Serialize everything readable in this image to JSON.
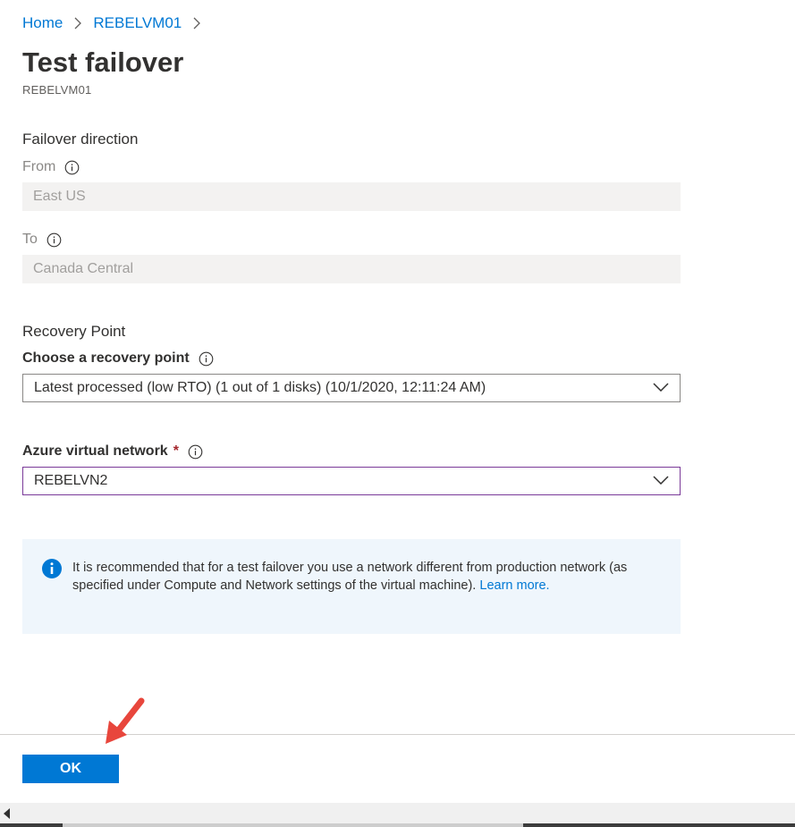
{
  "breadcrumb": {
    "home": "Home",
    "vm": "REBELVM01"
  },
  "header": {
    "title": "Test failover",
    "subtitle": "REBELVM01"
  },
  "failover_direction": {
    "section_label": "Failover direction",
    "from_label": "From",
    "from_value": "East US",
    "to_label": "To",
    "to_value": "Canada Central"
  },
  "recovery_point": {
    "section_label": "Recovery Point",
    "choose_label": "Choose a recovery point",
    "selected": "Latest processed (low RTO) (1 out of 1 disks) (10/1/2020, 12:11:24 AM)"
  },
  "network": {
    "label": "Azure virtual network",
    "required_mark": "*",
    "selected": "REBELVN2"
  },
  "info": {
    "text": "It is recommended that for a test failover you use a network different from production network (as specified under Compute and Network settings of the virtual machine).",
    "link": "Learn more."
  },
  "footer": {
    "ok_label": "OK"
  },
  "colors": {
    "accent": "#0078d4",
    "arrow": "#e8463c",
    "focus_border": "#7a3a99"
  }
}
